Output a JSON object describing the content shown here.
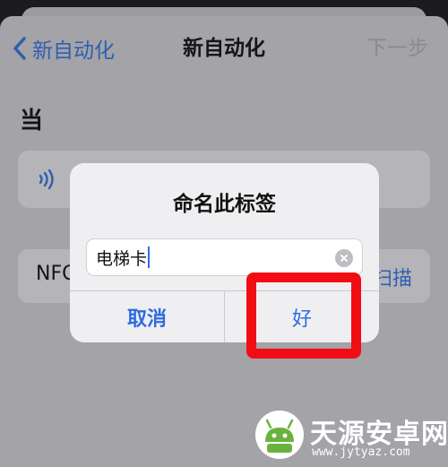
{
  "nav": {
    "back_label": "新自动化",
    "title": "新自动化",
    "next_label": "下一步"
  },
  "trigger": {
    "section_label": "当",
    "nfc_label": "NFC",
    "scan_label": "扫描"
  },
  "alert": {
    "title": "命名此标签",
    "field_value": "电梯卡",
    "cancel_label": "取消",
    "ok_label": "好"
  },
  "colors": {
    "accent": "#2f6be0",
    "highlight": "#f20d15"
  },
  "watermark": {
    "title": "天源安卓网",
    "url": "www.jytyaz.com"
  }
}
